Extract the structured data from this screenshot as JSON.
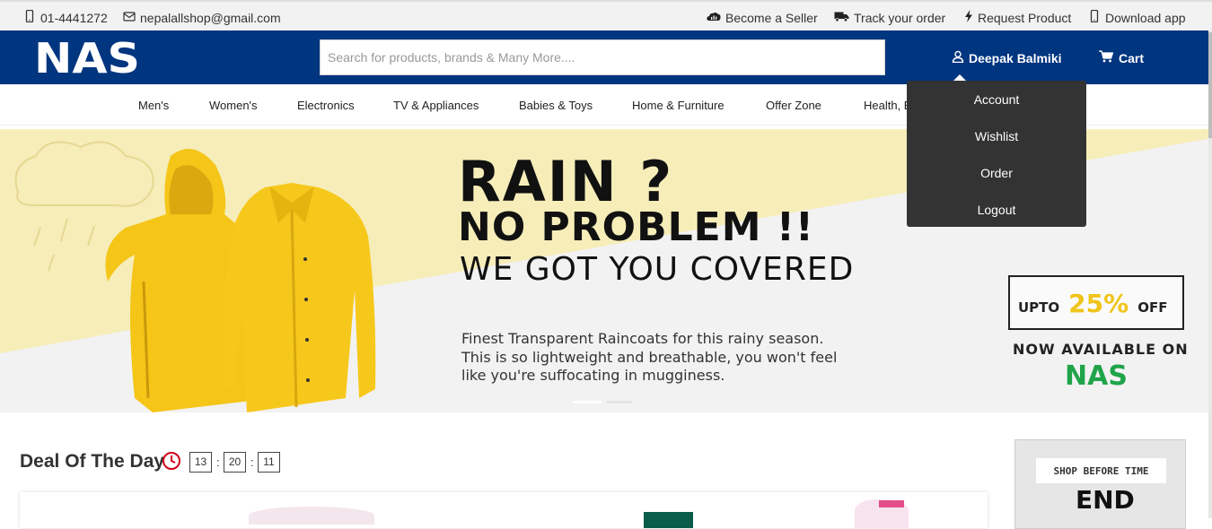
{
  "topbar": {
    "phone": "01-4441272",
    "email": "nepalallshop@gmail.com",
    "become_seller": "Become a Seller",
    "track_order": "Track your order",
    "request_product": "Request Product",
    "download_app": "Download app"
  },
  "header": {
    "logo": "NAS",
    "search_placeholder": "Search for products, brands & Many More....",
    "user_name": "Deepak Balmiki",
    "cart_label": "Cart"
  },
  "nav": [
    "Men's",
    "Women's",
    "Electronics",
    "TV & Appliances",
    "Babies & Toys",
    "Home & Furniture",
    "Offer Zone",
    "Health, B"
  ],
  "account_menu": [
    "Account",
    "Wishlist",
    "Order",
    "Logout"
  ],
  "banner": {
    "line1": "RAIN ?",
    "line2": "NO PROBLEM !!",
    "line3": "WE GOT YOU COVERED",
    "desc1": "Finest Transparent Raincoats for this rainy season.",
    "desc2": "This is so lightweight and breathable, you won't feel",
    "desc3": "like you're suffocating in mugginess.",
    "offer_upto": "UPTO",
    "offer_value": "25%",
    "offer_off": "OFF",
    "available": "NOW AVAILABLE ON",
    "brand": "NAS"
  },
  "deal": {
    "title": "Deal Of The Day",
    "hours": "13",
    "minutes": "20",
    "seconds": "11"
  },
  "side_ad": {
    "line1": "SHOP BEFORE TIME",
    "line2": "END"
  },
  "colors": {
    "header_bg": "#003580",
    "brand_green": "#1fa44a",
    "raincoat_yellow": "#f5c518",
    "offer_yellow": "#f0c419",
    "clock_red": "#d0021b"
  }
}
